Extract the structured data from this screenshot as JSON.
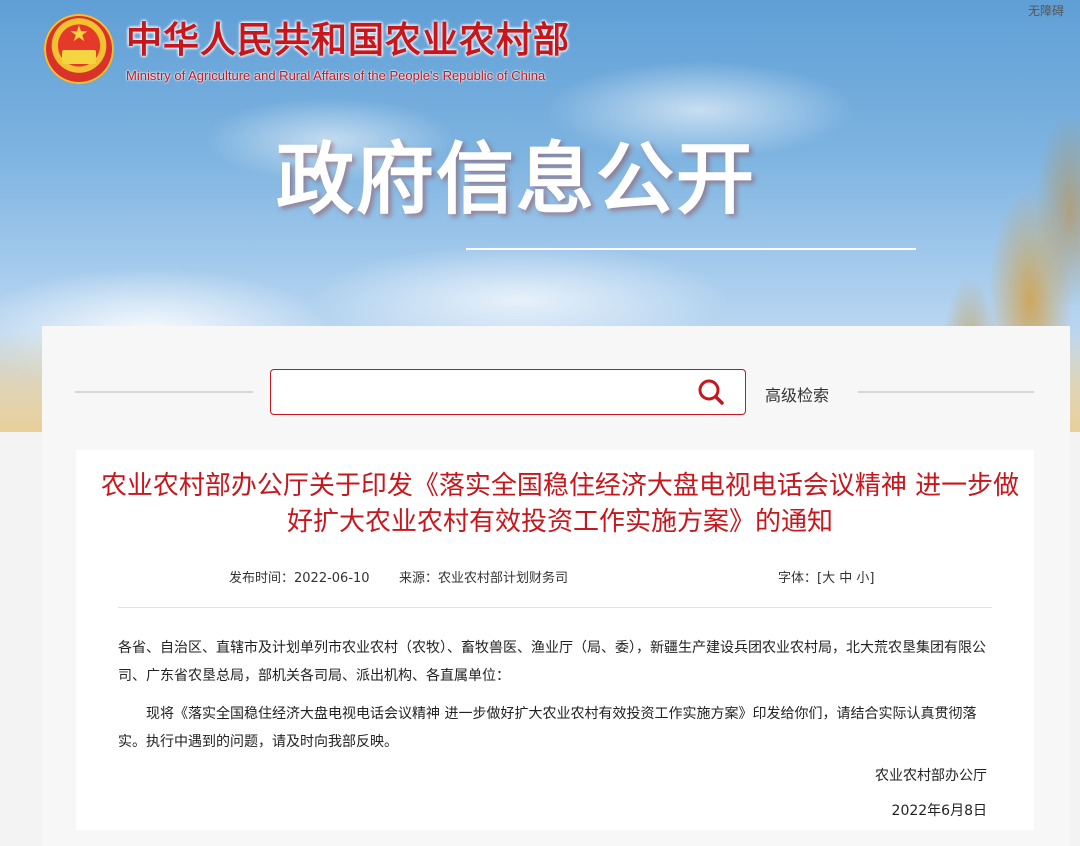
{
  "header": {
    "site_title": "中华人民共和国农业农村部",
    "site_subtitle": "Ministry of Agriculture and Rural Affairs of the People's Republic of China",
    "accessibility_label": "无障碍",
    "hero_title": "政府信息公开"
  },
  "search": {
    "placeholder": "",
    "value": "",
    "advanced_label": "高级检索"
  },
  "article": {
    "title": "农业农村部办公厅关于印发《落实全国稳住经济大盘电视电话会议精神 进一步做好扩大农业农村有效投资工作实施方案》的通知",
    "published_label": "发布时间：",
    "published_date": "2022-06-10",
    "source_label": "来源：",
    "source": "农业农村部计划财务司",
    "font_label": "字体：",
    "font_sizes": [
      "大",
      "中",
      "小"
    ],
    "paragraphs": [
      "各省、自治区、直辖市及计划单列市农业农村（农牧）、畜牧兽医、渔业厅（局、委），新疆生产建设兵团农业农村局，北大荒农垦集团有限公司、广东省农垦总局，部机关各司局、派出机构、各直属单位：",
      "现将《落实全国稳住经济大盘电视电话会议精神 进一步做好扩大农业农村有效投资工作实施方案》印发给你们，请结合实际认真贯彻落实。执行中遇到的问题，请及时向我部反映。"
    ],
    "signature_org": "农业农村部办公厅",
    "signature_date": "2022年6月8日"
  },
  "colors": {
    "brand_red": "#c8161d",
    "sky_blue": "#7db3e0"
  },
  "icons": [
    "national-emblem-icon",
    "search-icon"
  ]
}
